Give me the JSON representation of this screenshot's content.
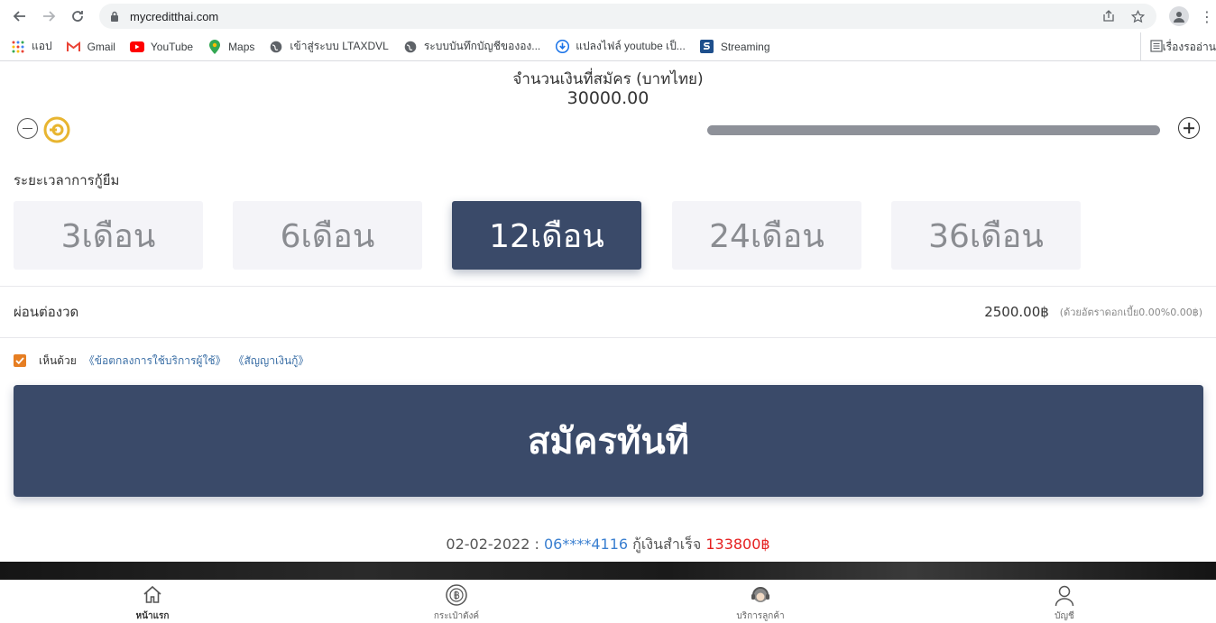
{
  "browser": {
    "url": "mycreditthai.com",
    "bookmarks": [
      {
        "label": "แอป",
        "icon": "apps-grid-icon"
      },
      {
        "label": "Gmail",
        "icon": "gmail-icon"
      },
      {
        "label": "YouTube",
        "icon": "youtube-icon"
      },
      {
        "label": "Maps",
        "icon": "maps-icon"
      },
      {
        "label": "เข้าสู่ระบบ LTAXDVL",
        "icon": "globe-icon"
      },
      {
        "label": "ระบบบันทึกบัญชีขององ...",
        "icon": "globe-icon"
      },
      {
        "label": "แปลงไฟล์ youtube เป็...",
        "icon": "download-icon"
      },
      {
        "label": "Streaming",
        "icon": "streaming-icon"
      }
    ],
    "reading_list": "เรื่องรออ่าน"
  },
  "loan": {
    "amount_title": "จำนวนเงินที่สมัคร (บาทไทย)",
    "amount_value": "30000.00",
    "slider_level": 1.0,
    "term_label": "ระยะเวลาการกู้ยืม",
    "terms": [
      "3เดือน",
      "6เดือน",
      "12เดือน",
      "24เดือน",
      "36เดือน"
    ],
    "selected_term": "12เดือน",
    "installment_label": "ผ่อนต่องวด",
    "installment_amount": "2500.00฿",
    "installment_rate": "(ด้วยอัตราดอกเบี้ย0.00%0.00฿)"
  },
  "agreement": {
    "checked": true,
    "text": "เห็นด้วย",
    "link_terms": "《ข้อตกลงการใช้บริการผู้ใช้》",
    "link_contract": "《สัญญาเงินกู้》"
  },
  "apply_button": "สมัครทันที",
  "ticker": {
    "date": "02-02-2022 :",
    "phone": "06****4116",
    "text": "กู้เงินสำเร็จ",
    "amount": "133800฿"
  },
  "tabs": [
    {
      "label": "หน้าแรก",
      "icon": "home-icon",
      "active": true
    },
    {
      "label": "กระเป๋าตังค์",
      "icon": "wallet-icon",
      "active": false
    },
    {
      "label": "บริการลูกค้า",
      "icon": "customer-service-icon",
      "active": false
    },
    {
      "label": "บัญชี",
      "icon": "user-icon",
      "active": false
    }
  ],
  "colors": {
    "primary": "#3a4a69",
    "accent_checkbox": "#e67e22",
    "link": "#3a6ea5",
    "amount_red": "#e52020"
  }
}
